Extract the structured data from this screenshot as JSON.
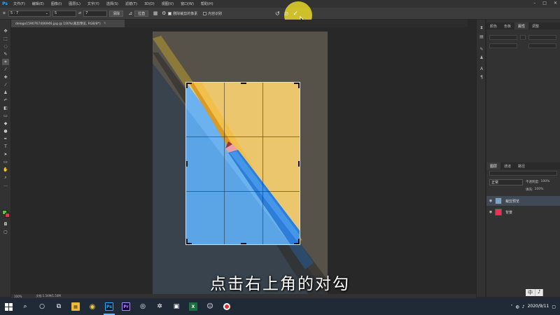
{
  "app": {
    "logo": "Ps"
  },
  "menu": [
    "文件(F)",
    "编辑(E)",
    "图像(I)",
    "图层(L)",
    "文字(Y)",
    "选择(S)",
    "滤镜(T)",
    "3D(D)",
    "视图(V)",
    "窗口(W)",
    "帮助(H)"
  ],
  "options": {
    "ratio_select": "5 : 7",
    "width_value": "5",
    "height_value": "7",
    "clear_button": "清除",
    "straighten_button": "拉直",
    "delete_cropped_label": "删除裁剪的像素",
    "content_aware_label": "内容识别",
    "commit_symbol": "✓",
    "reset_symbol": "↺",
    "cancel_symbol": "⊘"
  },
  "document": {
    "tab_title": "delogo1590767406946.jpg @ 100%(裁剪预览, RGB/8*)",
    "close_symbol": "×"
  },
  "status": {
    "zoom": "100%",
    "doc_size": "文档:1.54M/1.54M"
  },
  "panels": {
    "top_tabs": [
      "颜色",
      "色板",
      "属性",
      "调整"
    ],
    "layers_tabs": [
      "图层",
      "通道",
      "路径"
    ],
    "blend_mode": "正常",
    "opacity": "100%",
    "fill": "100%",
    "opacity_label": "不透明度:",
    "fill_label": "填充:",
    "layers": [
      {
        "name": "裁剪预览",
        "selected": true
      },
      {
        "name": "背景",
        "selected": false
      }
    ]
  },
  "subtitle": "点击右上角的对勾",
  "taskbar": {
    "apps": [
      {
        "name": "file-explorer",
        "symbol": "▦"
      },
      {
        "name": "chrome",
        "symbol": "◉"
      },
      {
        "name": "photoshop",
        "symbol": "Ps"
      },
      {
        "name": "premiere",
        "symbol": "Pr"
      }
    ],
    "date": "2020/9/11",
    "ime": [
      "中",
      "♪"
    ]
  },
  "colors": {
    "fg": "#5ec53e",
    "bg": "#e83353",
    "ps_blue": "#31a8ff",
    "pr_purple": "#9999ff"
  }
}
